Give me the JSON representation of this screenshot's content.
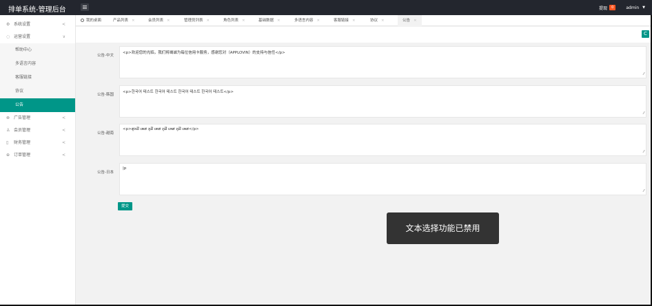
{
  "app": {
    "title": "排单系统-管理后台"
  },
  "header": {
    "withdraw_label": "提现",
    "withdraw_count": "0",
    "user": "admin",
    "user_caret": "▼"
  },
  "sidebar": {
    "items": [
      {
        "label": "系统设置",
        "icon": "gear-icon",
        "arrow": "<"
      },
      {
        "label": "运营设置",
        "icon": "globe-icon",
        "arrow": "∨"
      },
      {
        "label": "广告管理",
        "icon": "ad-icon",
        "arrow": "<"
      },
      {
        "label": "会员管理",
        "icon": "user-icon",
        "arrow": "<"
      },
      {
        "label": "财务管理",
        "icon": "lock-icon",
        "arrow": "<"
      },
      {
        "label": "订单管理",
        "icon": "order-icon",
        "arrow": "<"
      }
    ],
    "sub_items": [
      "帮助中心",
      "多语言内容",
      "客服链接",
      "协议",
      "公告"
    ]
  },
  "tabs": [
    {
      "label": "我的桌面",
      "x": ""
    },
    {
      "label": "产品列表",
      "x": "×"
    },
    {
      "label": "会员列表",
      "x": "×"
    },
    {
      "label": "管理员列表",
      "x": "×"
    },
    {
      "label": "角色列表",
      "x": "×"
    },
    {
      "label": "基础数据",
      "x": "×"
    },
    {
      "label": "多语言内容",
      "x": "×"
    },
    {
      "label": "客服链接",
      "x": "×"
    },
    {
      "label": "协议",
      "x": "×"
    },
    {
      "label": "公告",
      "x": "×"
    }
  ],
  "toolbar": {
    "refresh_icon": "C"
  },
  "form": {
    "fields": [
      {
        "label": "公告-中文",
        "value": "<p>欢迎您的光临，我们将竭诚为每位信用卡服务，感谢您对（APPLOVIN）的支持与信任</p>"
      },
      {
        "label": "公告-韩国",
        "value": "<p>한국어 테스트 한국어 테스트 한국어 테스트 한국어 테스트</p>"
      },
      {
        "label": "公告-越南",
        "value": "<p>ສູກລີ ເທສ ກູລີ ເທສ ກູລີ ເທສ ກູລີ ເທສ</p>"
      },
      {
        "label": "公告-日本",
        "value": "|p"
      }
    ],
    "submit_label": "提交",
    "resize_glyph": "⁄⁄"
  },
  "toast": {
    "message": "文本选择功能已禁用"
  }
}
